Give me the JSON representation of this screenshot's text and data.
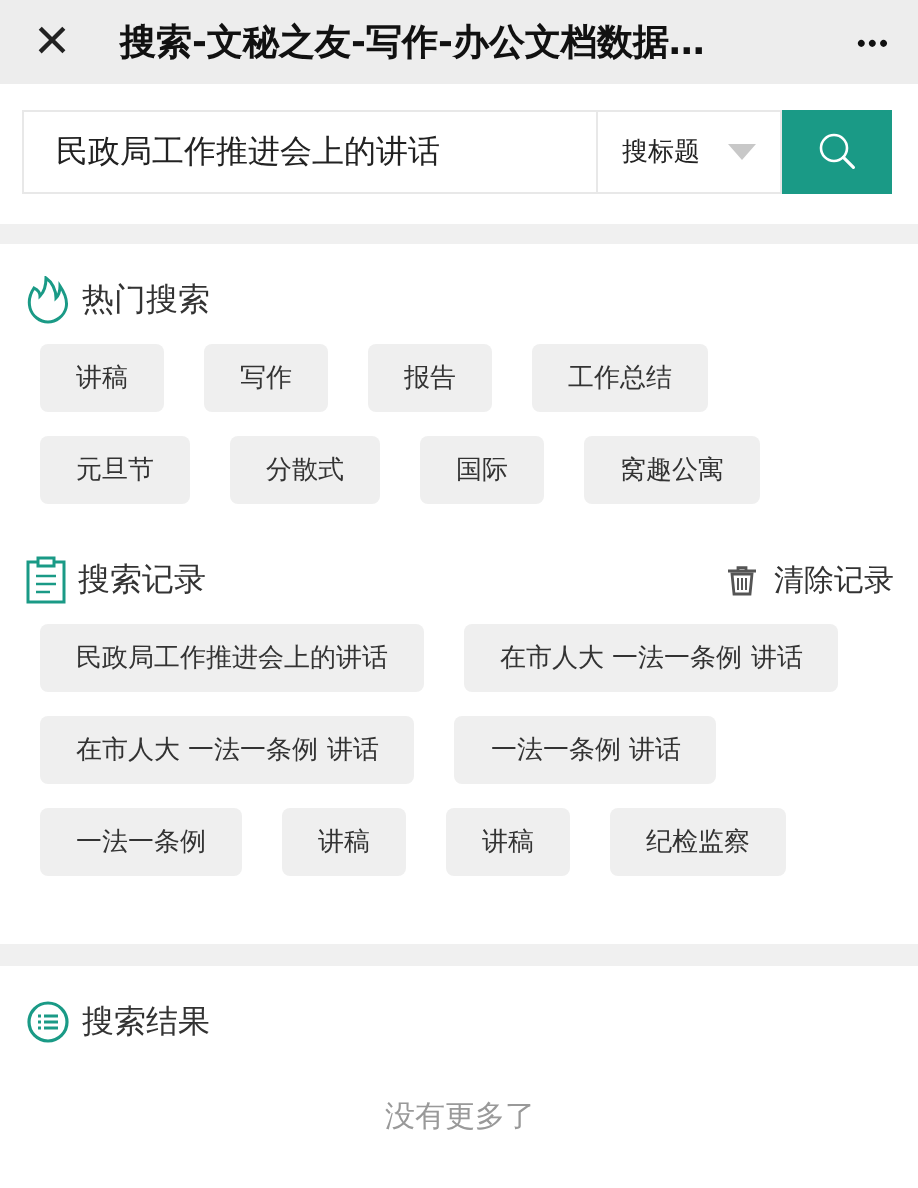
{
  "header": {
    "close_icon": "×",
    "title": "搜索-文秘之友-写作-办公文档数据…",
    "more": "•••"
  },
  "search": {
    "value": "民政局工作推进会上的讲话",
    "scope": "搜标题"
  },
  "hot": {
    "title": "热门搜索",
    "tags": [
      "讲稿",
      "写作",
      "报告",
      "工作总结",
      "元旦节",
      "分散式",
      "国际",
      "窝趣公寓"
    ]
  },
  "history": {
    "title": "搜索记录",
    "clear": "清除记录",
    "tags": [
      "民政局工作推进会上的讲话",
      "在市人大 一法一条例 讲话",
      "在市人大 一法一条例 讲话",
      "一法一条例 讲话",
      "一法一条例",
      "讲稿",
      "讲稿",
      "纪检监察"
    ]
  },
  "results": {
    "title": "搜索结果",
    "empty": "没有更多了"
  }
}
